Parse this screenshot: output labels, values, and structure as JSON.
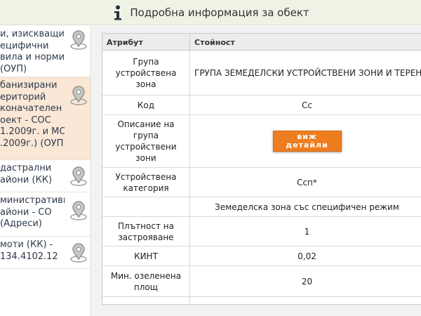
{
  "header": {
    "title": "Подробна информация за обект",
    "icon": "info-icon"
  },
  "sidebar": {
    "items": [
      {
        "label": "и, изискващи\nецифични\nвила и норми\n(ОУП)",
        "icon": "map-pin-icon",
        "active": false
      },
      {
        "label": "банизирани\nериторий\nконачателен\nоект - СОС\n1.2009г. и МС\n.2009г.) (ОУП)",
        "icon": "map-pin-icon",
        "active": true
      },
      {
        "label": "дастрални\nайони (КК)",
        "icon": "map-pin-icon",
        "active": false
      },
      {
        "label": "министративни\nайони - СО\n(Адреси)",
        "icon": "map-pin-icon",
        "active": false
      },
      {
        "label": "моти (КК) -\n134.4102.12",
        "icon": "map-pin-icon",
        "active": false
      }
    ]
  },
  "table": {
    "headers": {
      "attribute": "Атрибут",
      "value": "Стойност"
    },
    "rows": [
      {
        "attribute": "Група\nустройствена\nзона",
        "value": "ГРУПА ЗЕМЕДЕЛСКИ УСТРОЙСТВЕНИ ЗОНИ И ТЕРЕНИ"
      },
      {
        "attribute": "Код",
        "value": "Сс"
      },
      {
        "attribute": "Описание на\nгрупа\nустройствени\nзони",
        "button_line1": "виж",
        "button_line2": "детайли"
      },
      {
        "attribute": "Устройствена\nкатегория",
        "value": "Ссп*"
      },
      {
        "attribute": "",
        "value": "Земеделска зона със специфичен режим"
      },
      {
        "attribute": "Плътност на\nзастрояване",
        "value": "1"
      },
      {
        "attribute": "КИНТ",
        "value": "0,02"
      },
      {
        "attribute": "Мин. озеленена\nплощ",
        "value": "20"
      }
    ]
  },
  "colors": {
    "accent": "#ee7d1f",
    "header_bg": "#eef3e6",
    "active_item_bg": "#fbe7d6"
  }
}
